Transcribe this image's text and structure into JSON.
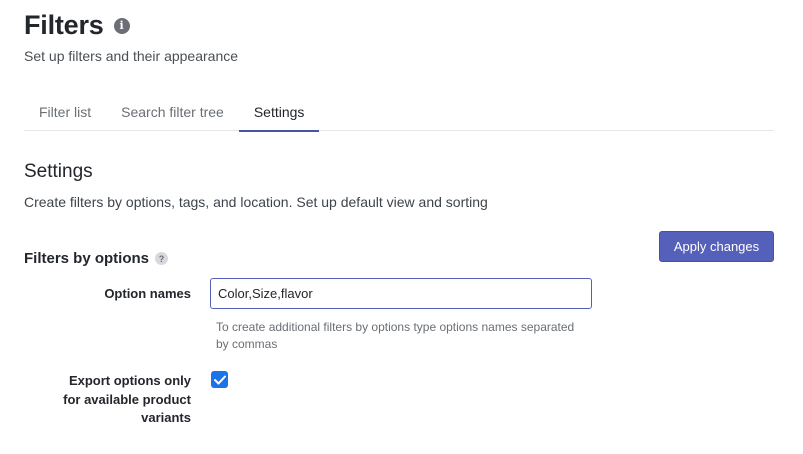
{
  "header": {
    "title": "Filters",
    "subtitle": "Set up filters and their appearance",
    "info_icon": "info-icon"
  },
  "tabs": [
    {
      "label": "Filter list",
      "active": false
    },
    {
      "label": "Search filter tree",
      "active": false
    },
    {
      "label": "Settings",
      "active": true
    }
  ],
  "section": {
    "title": "Settings",
    "description": "Create filters by options, tags, and location. Set up default view and sorting",
    "apply_label": "Apply changes"
  },
  "filters_by_options": {
    "title": "Filters by options",
    "help_icon": "question-icon",
    "option_names": {
      "label": "Option names",
      "value": "Color,Size,flavor",
      "hint": "To create additional filters by options type options names separated by commas"
    },
    "export_options": {
      "label": "Export options only for available product variants",
      "checked": true
    }
  },
  "colors": {
    "accent": "#5460b9",
    "checkbox": "#1a73e8"
  }
}
